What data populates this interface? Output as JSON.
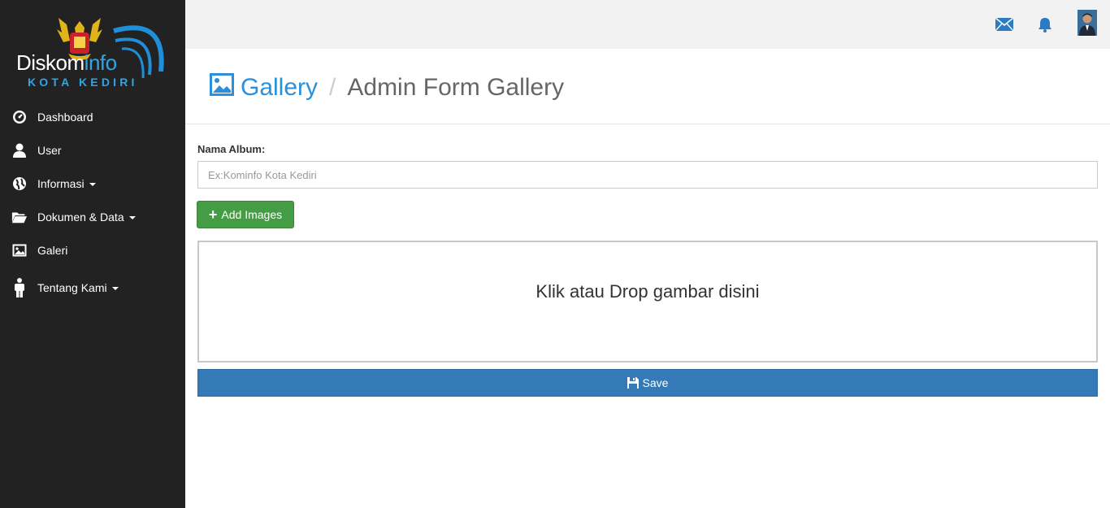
{
  "logo": {
    "main_white": "Diskom",
    "main_blue": "info",
    "sub": "KOTA KEDIRI"
  },
  "sidebar": {
    "items": [
      {
        "label": "Dashboard",
        "icon": "dashboard-icon",
        "dropdown": false
      },
      {
        "label": "User",
        "icon": "user-icon",
        "dropdown": false
      },
      {
        "label": "Informasi",
        "icon": "globe-icon",
        "dropdown": true
      },
      {
        "label": "Dokumen & Data",
        "icon": "folder-open-icon",
        "dropdown": true
      },
      {
        "label": "Galeri",
        "icon": "picture-icon",
        "dropdown": false
      },
      {
        "label": "Tentang Kami",
        "icon": "person-icon",
        "dropdown": true
      }
    ]
  },
  "topbar": {
    "icons": [
      "envelope-icon",
      "bell-icon",
      "avatar"
    ],
    "accent": "#2a7bc4"
  },
  "header": {
    "section": "Gallery",
    "separator": "/",
    "current": "Admin Form Gallery"
  },
  "form": {
    "album_label": "Nama Album:",
    "album_placeholder": "Ex:Kominfo Kota Kediri",
    "album_value": "",
    "add_images_label": "Add Images",
    "dropzone_message": "Klik atau Drop gambar disini",
    "save_label": "Save"
  },
  "colors": {
    "sidebar_bg": "#222222",
    "topbar_bg": "#f2f2f2",
    "primary": "#337ab7",
    "success": "#449d44",
    "link": "#2a8fdc"
  }
}
